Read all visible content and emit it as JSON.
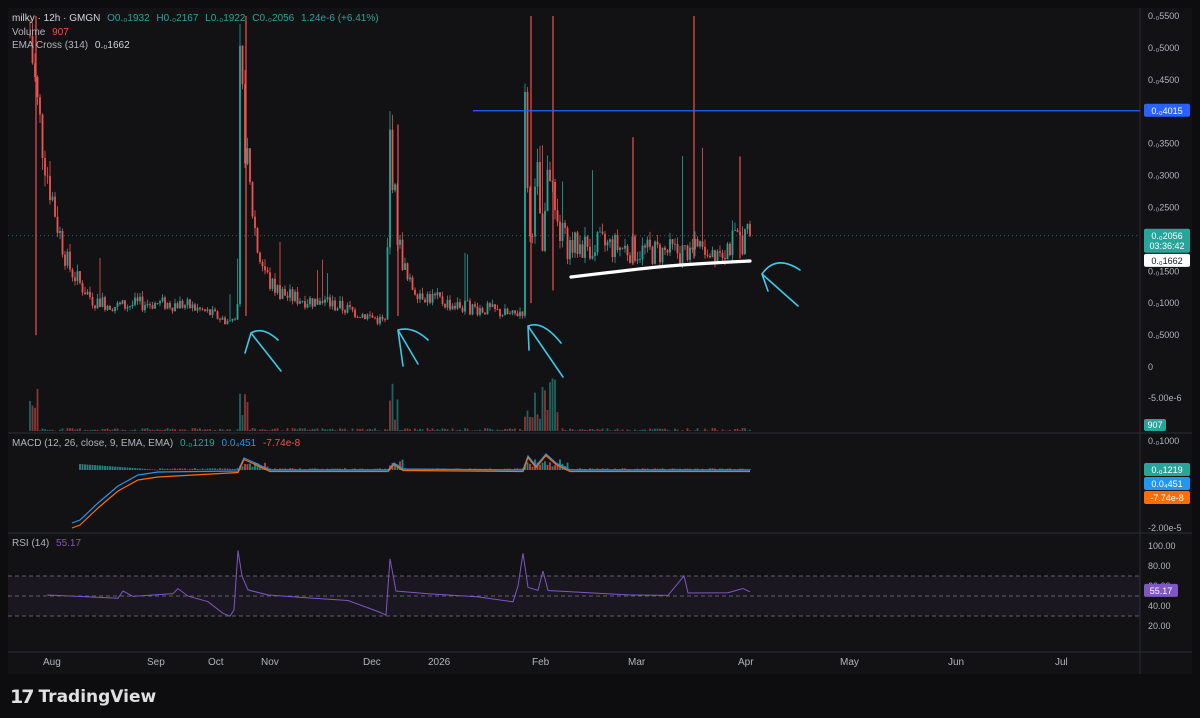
{
  "header": {
    "symbol": "milky · 12h · GMGN",
    "open": "O0.₀1932",
    "high": "H0.₀2167",
    "low": "L0.₀1922",
    "close": "C0.₀2056",
    "change": "1.24e-6 (+6.41%)",
    "volume_label": "Volume",
    "volume_value": "907",
    "ema_label": "EMA Cross (314)",
    "ema_value": "0.₀1662"
  },
  "macd_legend": {
    "label": "MACD (12, 26, close, 9, EMA, EMA)",
    "v1": "0.₀1219",
    "v2": "0.0₄451",
    "v3": "-7.74e-8"
  },
  "rsi_legend": {
    "label": "RSI (14)",
    "value": "55.17"
  },
  "price_axis": [
    "0.₀5500",
    "0.₀5000",
    "0.₀4500",
    "0.₀3500",
    "0.₀3000",
    "0.₀2500",
    "0.₀1500",
    "0.₀1000",
    "0.₀5000",
    "0",
    "-5.00e-6"
  ],
  "price_badges": {
    "hline": "0.₀4015",
    "last_price": "0.₀2056",
    "countdown": "03:36:42",
    "ema": "0.₀1662",
    "volume": "907"
  },
  "macd_axis": [
    "0.₀1000",
    "-2.00e-5"
  ],
  "macd_badges": [
    "0.₀1219",
    "0.0₄451",
    "-7.74e-8"
  ],
  "rsi_axis": [
    "100.00",
    "80.00",
    "60.00",
    "40.00",
    "20.00"
  ],
  "rsi_badge": "55.17",
  "time_axis": [
    "Aug",
    "Sep",
    "Oct",
    "Nov",
    "Dec",
    "2026",
    "Feb",
    "Mar",
    "Apr",
    "May",
    "Jun",
    "Jul"
  ],
  "branding": {
    "logo_mark": "17",
    "name": "TradingView"
  },
  "colors": {
    "up": "#26a69a",
    "down": "#ef5350",
    "hline": "#2962ff",
    "macd_line": "#2196f3",
    "signal_line": "#ff6d00",
    "rsi": "#7e57c2",
    "annotation": "#3cc8e6",
    "ema_mark": "#ffffff"
  },
  "chart_data": {
    "type": "line",
    "description_series": [
      {
        "name": "price (close, approx)",
        "x": [
          "Aug",
          "Aug",
          "Sep",
          "Oct",
          "Oct",
          "Oct",
          "Nov",
          "Dec",
          "Dec",
          "Dec",
          "2026",
          "Jan",
          "Feb",
          "Feb",
          "Mar",
          "Mar",
          "Apr"
        ],
        "values": [
          0.00052,
          0.00011,
          0.0001,
          7e-05,
          0.00045,
          0.00014,
          0.00011,
          7e-05,
          0.00036,
          0.00013,
          0.0001,
          8e-05,
          0.00055,
          0.0002,
          0.00019,
          0.0002,
          0.00021
        ]
      }
    ],
    "horizontal_line": 0.0004015,
    "ema_cross_last": 0.0001662,
    "last_close": 0.0002056,
    "rsi_last": 55.17,
    "rsi_bands": [
      70,
      50,
      30
    ],
    "ylim_price": [
      -5e-06,
      0.00055
    ]
  }
}
